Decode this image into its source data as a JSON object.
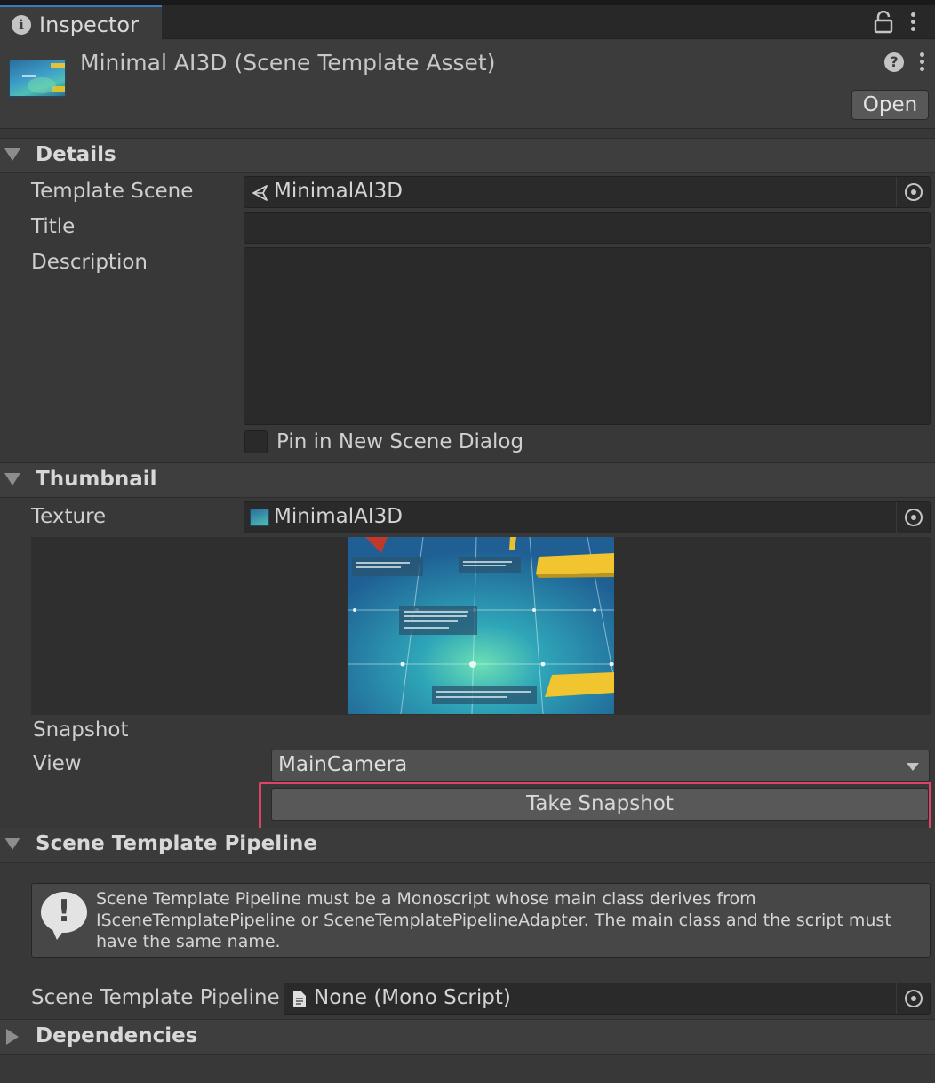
{
  "tab": {
    "icon": "info-icon",
    "label": "Inspector"
  },
  "toolbar": {
    "lock_icon": "lock-icon",
    "menu_icon": "kebab-menu-icon"
  },
  "header": {
    "title": "Minimal AI3D (Scene Template Asset)",
    "help_icon": "?",
    "open_label": "Open"
  },
  "details": {
    "heading": "Details",
    "template_scene_label": "Template Scene",
    "template_scene_value": "MinimalAI3D",
    "title_label": "Title",
    "title_value": "",
    "description_label": "Description",
    "description_value": "",
    "pin_label": "Pin in New Scene Dialog",
    "pin_checked": false
  },
  "thumbnail": {
    "heading": "Thumbnail",
    "texture_label": "Texture",
    "texture_value": "MinimalAI3D",
    "snapshot_label": "Snapshot",
    "view_label": "View",
    "view_value": "MainCamera",
    "take_snapshot_label": "Take Snapshot"
  },
  "pipeline": {
    "heading": "Scene Template Pipeline",
    "warning_icon": "!",
    "warning_text": "Scene Template Pipeline must be a Monoscript whose main class derives from ISceneTemplatePipeline or SceneTemplatePipelineAdapter. The main class and the script must have the same name.",
    "field_label": "Scene Template Pipeline",
    "field_value": "None (Mono Script)"
  },
  "dependencies": {
    "heading": "Dependencies"
  },
  "colors": {
    "highlight": "#e0426b",
    "tab_accent": "#3a79bb"
  }
}
